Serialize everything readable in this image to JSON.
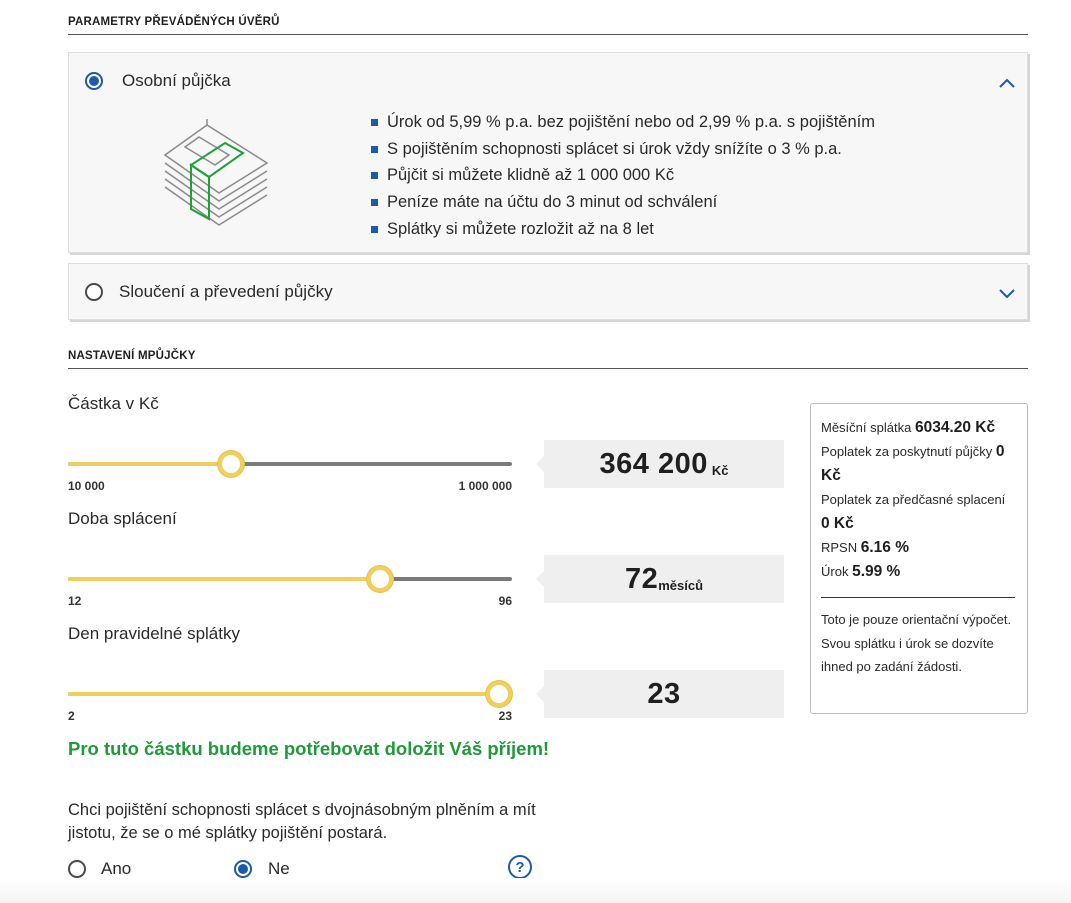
{
  "loan_params": {
    "title": "PARAMETRY PŘEVÁDĚNÝCH ÚVĚRŮ",
    "options": [
      {
        "label": "Osobní půjčka",
        "selected": true,
        "expanded": true,
        "icon": "money-stack-icon",
        "bullets": [
          "Úrok od 5,99 % p.a. bez pojištění nebo od 2,99 % p.a. s pojištěním",
          "S pojištěním schopnosti splácet si úrok vždy snížíte o 3 % p.a.",
          "Půjčit si můžete klidně až 1 000 000 Kč",
          "Peníze máte na účtu do 3 minut od schválení",
          "Splátky si můžete rozložit až na 8 let"
        ]
      },
      {
        "label": "Sloučení a převedení půjčky",
        "selected": false,
        "expanded": false
      }
    ]
  },
  "loan_settings": {
    "title": "NASTAVENÍ MPŮJČKY",
    "amount": {
      "label": "Částka v Kč",
      "min_label": "10 000",
      "max_label": "1 000 000",
      "value": "364 200",
      "unit": "Kč",
      "min": 10000,
      "max": 1000000,
      "current": 364200
    },
    "term": {
      "label": "Doba splácení",
      "min_label": "12",
      "max_label": "96",
      "value": "72",
      "unit": "měsíců",
      "min": 12,
      "max": 96,
      "current": 72
    },
    "day": {
      "label": "Den pravidelné splátky",
      "min_label": "2",
      "max_label": "23",
      "value": "23",
      "unit": "",
      "min": 2,
      "max": 23,
      "current": 23
    }
  },
  "summary": {
    "monthly_label": "Měsíční splátka",
    "monthly_value": "6034.20 Kč",
    "fee_grant_label": "Poplatek za poskytnutí půjčky",
    "fee_grant_value": "0 Kč",
    "fee_early_label": "Poplatek za předčasné splacení",
    "fee_early_value": "0 Kč",
    "rpsn_label": "RPSN",
    "rpsn_value": "6.16 %",
    "rate_label": "Úrok",
    "rate_value": "5.99 %",
    "note": "Toto je pouze orientační výpočet. Svou splátku i úrok se dozvíte ihned po zadání žádosti."
  },
  "income_message": "Pro tuto částku budeme potřebovat doložit Váš příjem!",
  "insurance": {
    "question": "Chci pojištění schopnosti splácet s dvojnásobným plněním a mít jistotu, že se o mé splátky pojištění postará.",
    "yes_label": "Ano",
    "no_label": "Ne",
    "selected": "Ne",
    "help_symbol": "?"
  },
  "colors": {
    "accent_blue": "#1d5aa9",
    "slider_yellow": "#f1cf5c",
    "success_green": "#1e9a3a",
    "icon_green": "#1fa03a"
  }
}
